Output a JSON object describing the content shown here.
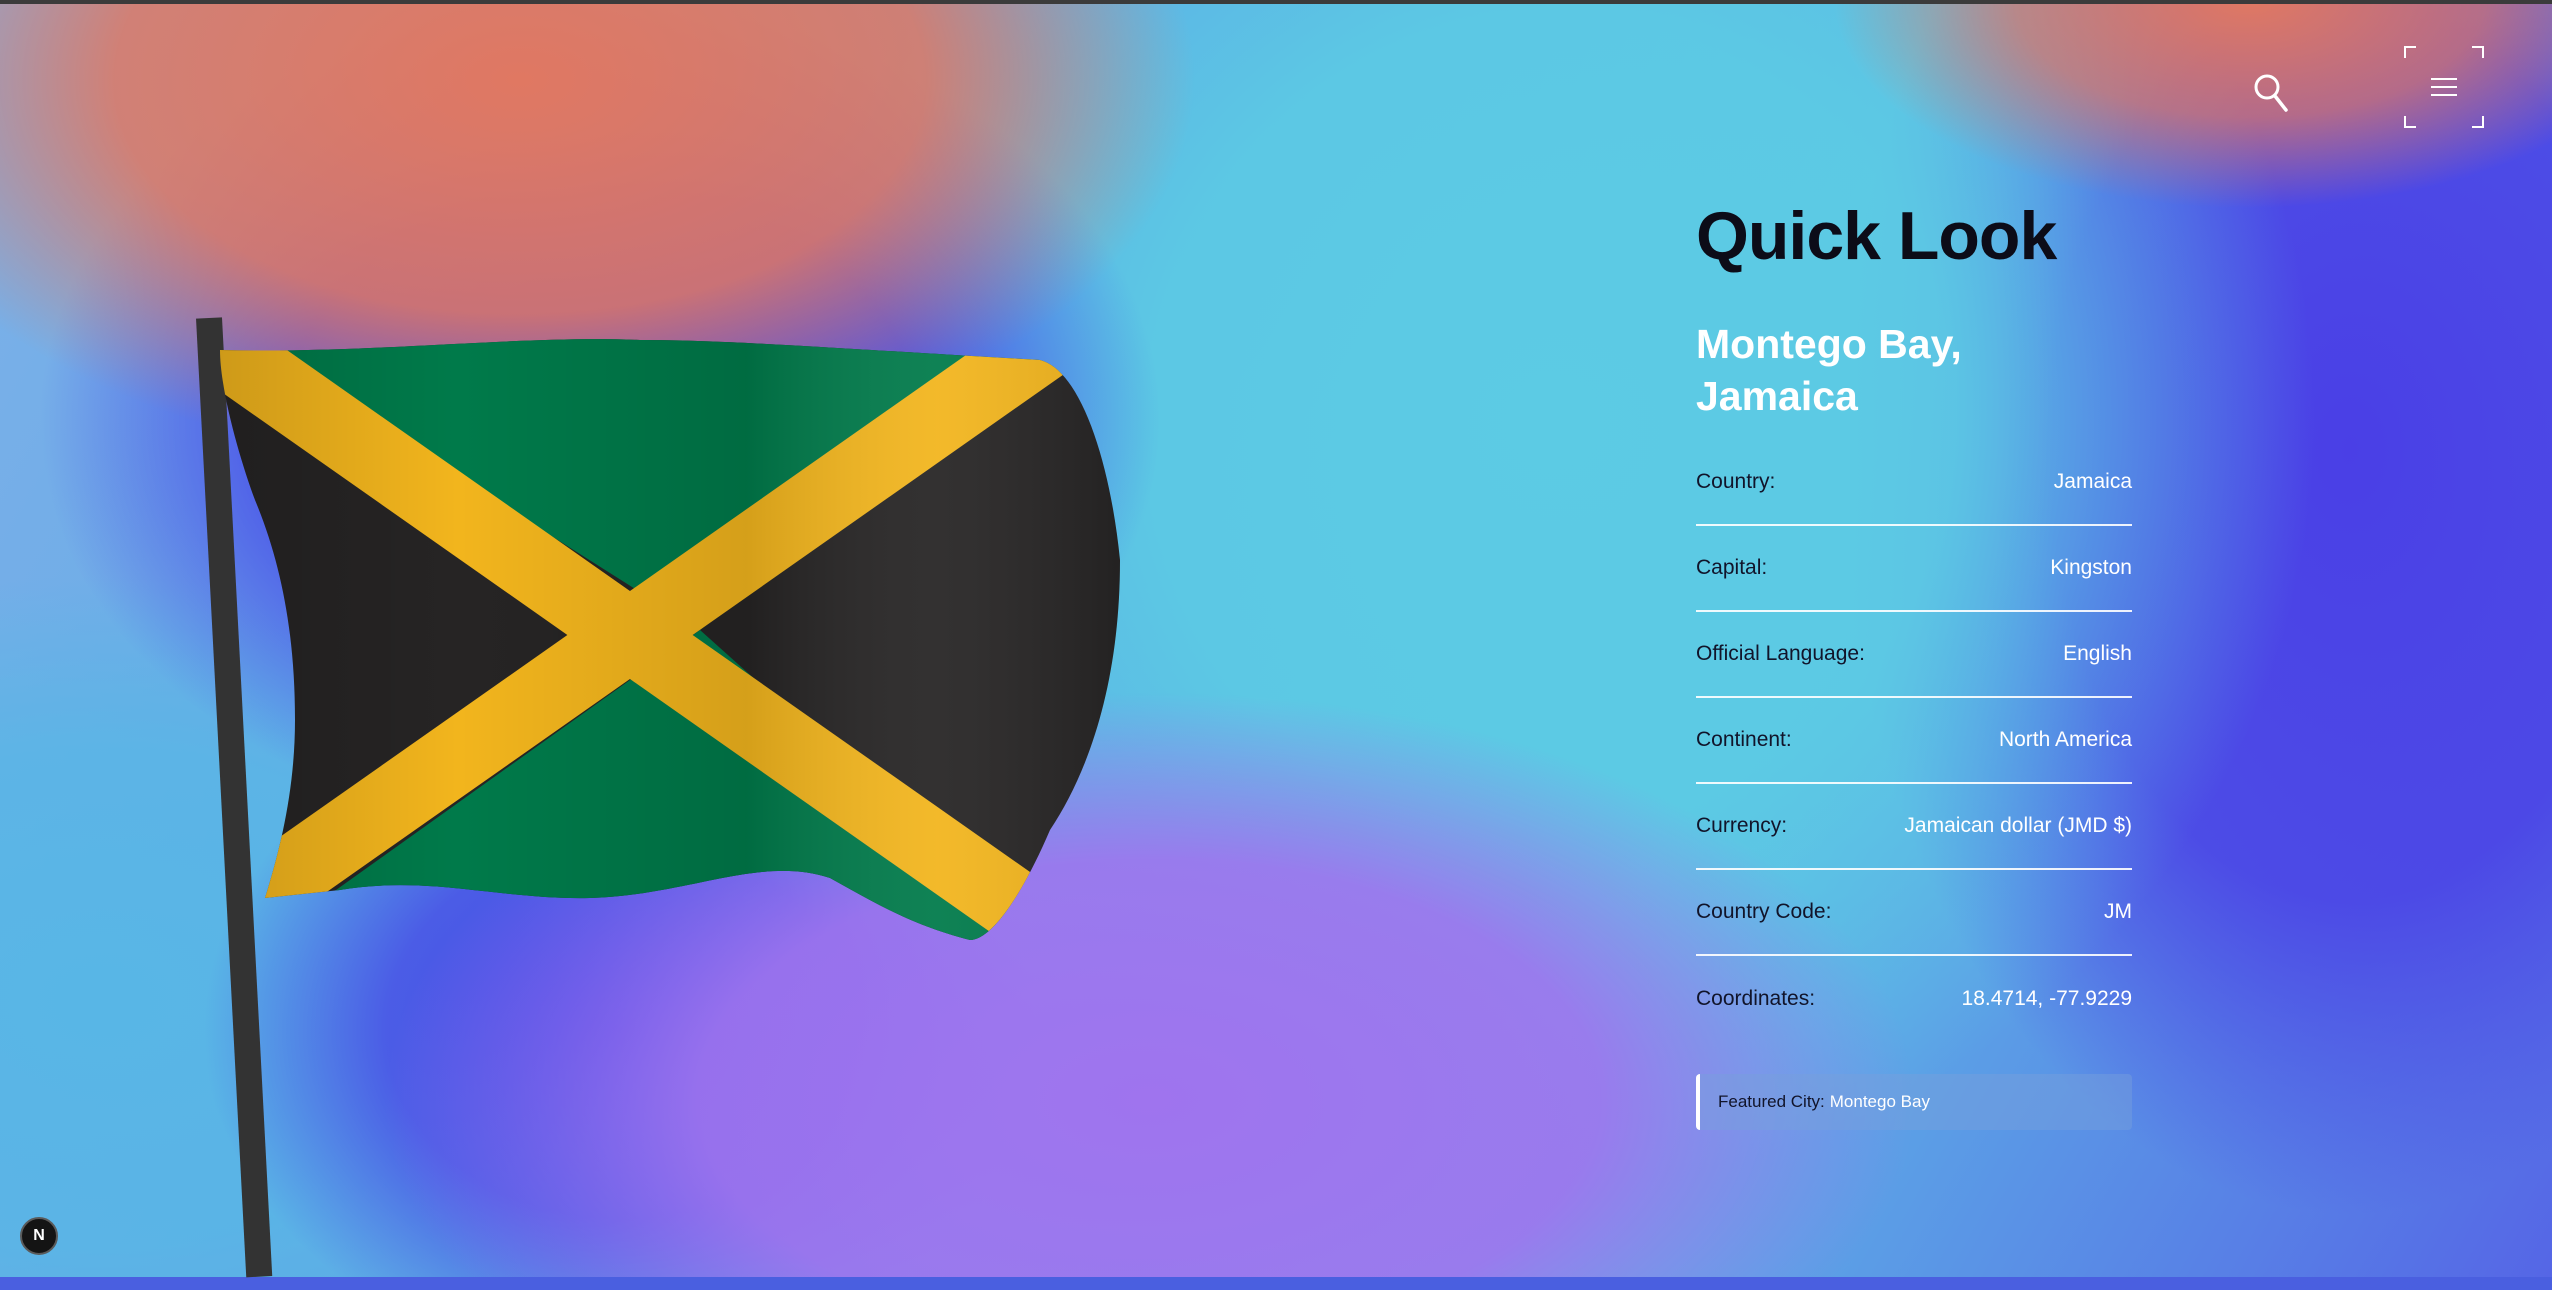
{
  "header": {
    "search_icon": "search-icon",
    "menu_icon": "hamburger-menu-icon"
  },
  "hero": {
    "flag_icon": "jamaica-flag",
    "flag_colors": {
      "green": "#007a4a",
      "gold": "#f2b51d",
      "black": "#262424",
      "pole": "#333333"
    }
  },
  "quick_look": {
    "title": "Quick Look",
    "location": "Montego Bay, Jamaica",
    "rows": [
      {
        "label": "Country:",
        "value": "Jamaica"
      },
      {
        "label": "Capital:",
        "value": "Kingston"
      },
      {
        "label": "Official Language:",
        "value": "English"
      },
      {
        "label": "Continent:",
        "value": "North America"
      },
      {
        "label": "Currency:",
        "value": "Jamaican dollar (JMD $)"
      },
      {
        "label": "Country Code:",
        "value": "JM"
      },
      {
        "label": "Coordinates:",
        "value": "18.4714, -77.9229"
      }
    ],
    "featured": {
      "label": "Featured City:",
      "value": "Montego Bay"
    }
  },
  "badge": {
    "text": "N"
  }
}
